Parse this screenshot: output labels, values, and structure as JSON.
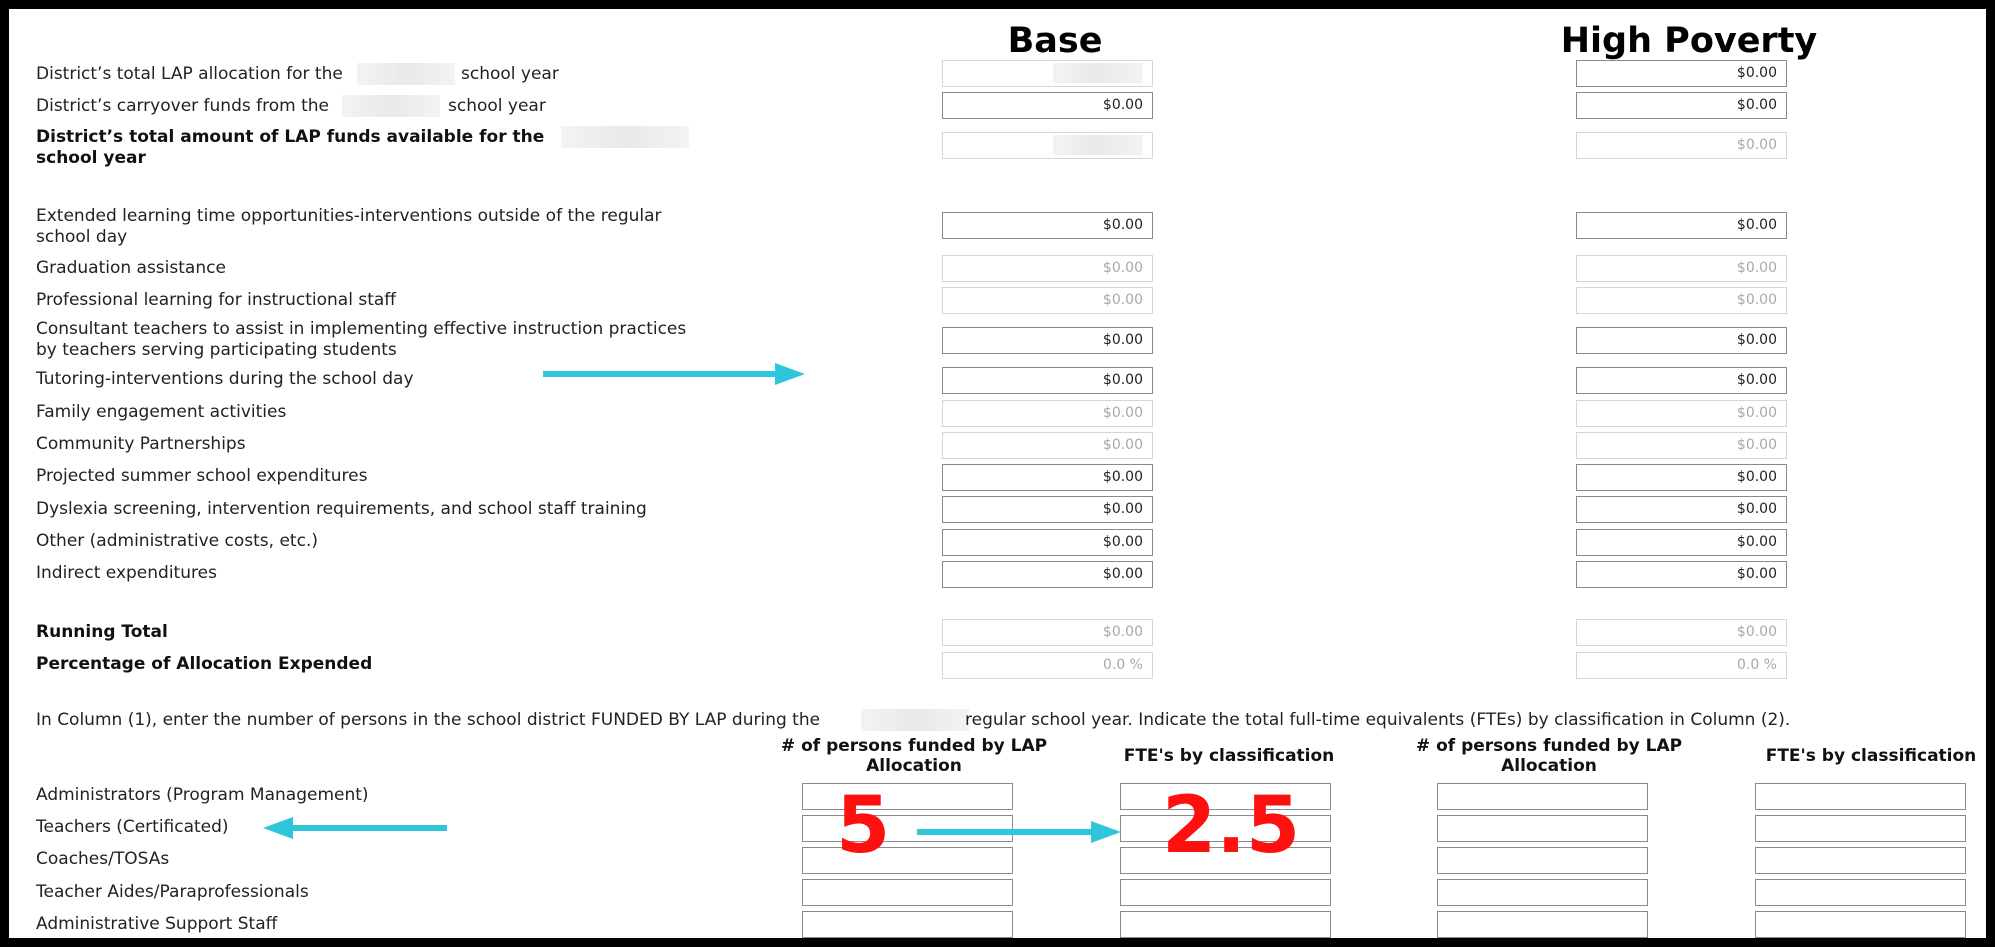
{
  "headers": {
    "base": "Base",
    "high_poverty": "High Poverty"
  },
  "top_rows": [
    {
      "pre": "District’s total LAP allocation for the",
      "post": "school year",
      "bold": false,
      "base": "",
      "base_ro": true,
      "hp": "$0.00",
      "hp_ro": false
    },
    {
      "pre": "District’s carryover funds from the",
      "post": "school year",
      "bold": false,
      "base": "$0.00",
      "base_ro": false,
      "hp": "$0.00",
      "hp_ro": false
    },
    {
      "pre": "District’s total amount of LAP funds available for the",
      "line2": "school year",
      "bold": true,
      "base": "",
      "base_ro": true,
      "hp": "$0.00",
      "hp_ro": true
    }
  ],
  "expense_rows": [
    {
      "label": "Extended learning time opportunities-interventions outside of the regular",
      "label2": "school day",
      "base": "$0.00",
      "base_ro": false,
      "hp": "$0.00",
      "hp_ro": false
    },
    {
      "label": "Graduation assistance",
      "base": "$0.00",
      "base_ro": true,
      "hp": "$0.00",
      "hp_ro": true
    },
    {
      "label": "Professional learning for instructional staff",
      "base": "$0.00",
      "base_ro": true,
      "hp": "$0.00",
      "hp_ro": true
    },
    {
      "label": "Consultant teachers to assist in implementing effective instruction practices",
      "label2": "by teachers serving participating students",
      "base": "$0.00",
      "base_ro": false,
      "hp": "$0.00",
      "hp_ro": false
    },
    {
      "label": "Tutoring-interventions during the school day",
      "base": "$0.00",
      "base_ro": false,
      "hp": "$0.00",
      "hp_ro": false
    },
    {
      "label": "Family engagement activities",
      "base": "$0.00",
      "base_ro": true,
      "hp": "$0.00",
      "hp_ro": true
    },
    {
      "label": "Community Partnerships",
      "base": "$0.00",
      "base_ro": true,
      "hp": "$0.00",
      "hp_ro": true
    },
    {
      "label": "Projected summer school expenditures",
      "base": "$0.00",
      "base_ro": false,
      "hp": "$0.00",
      "hp_ro": false
    },
    {
      "label": "Dyslexia screening, intervention requirements, and school staff training",
      "base": "$0.00",
      "base_ro": false,
      "hp": "$0.00",
      "hp_ro": false
    },
    {
      "label": "Other (administrative costs, etc.)",
      "base": "$0.00",
      "base_ro": false,
      "hp": "$0.00",
      "hp_ro": false
    },
    {
      "label": "Indirect expenditures",
      "base": "$0.00",
      "base_ro": false,
      "hp": "$0.00",
      "hp_ro": false
    }
  ],
  "totals": [
    {
      "label": "Running Total",
      "base": "$0.00",
      "hp": "$0.00"
    },
    {
      "label": "Percentage of Allocation Expended",
      "base": "0.0 %",
      "hp": "0.0 %"
    }
  ],
  "instruction": {
    "pre": "In Column (1), enter the number of persons in the school district FUNDED BY LAP during the",
    "post": "regular school year. Indicate the total full-time equivalents (FTEs) by classification in Column (2)."
  },
  "fte_headers": {
    "persons_line1": "# of persons funded by LAP",
    "persons_line2": "Allocation",
    "fte": "FTE's by classification"
  },
  "fte_rows": [
    "Administrators (Program Management)",
    "Teachers (Certificated)",
    "Coaches/TOSAs",
    "Teacher Aides/Paraprofessionals",
    "Administrative Support Staff"
  ],
  "annotations": {
    "persons_example": "5",
    "fte_example": "2.5",
    "arrow_color": "#2fc6dc",
    "number_color": "#ff1010"
  }
}
